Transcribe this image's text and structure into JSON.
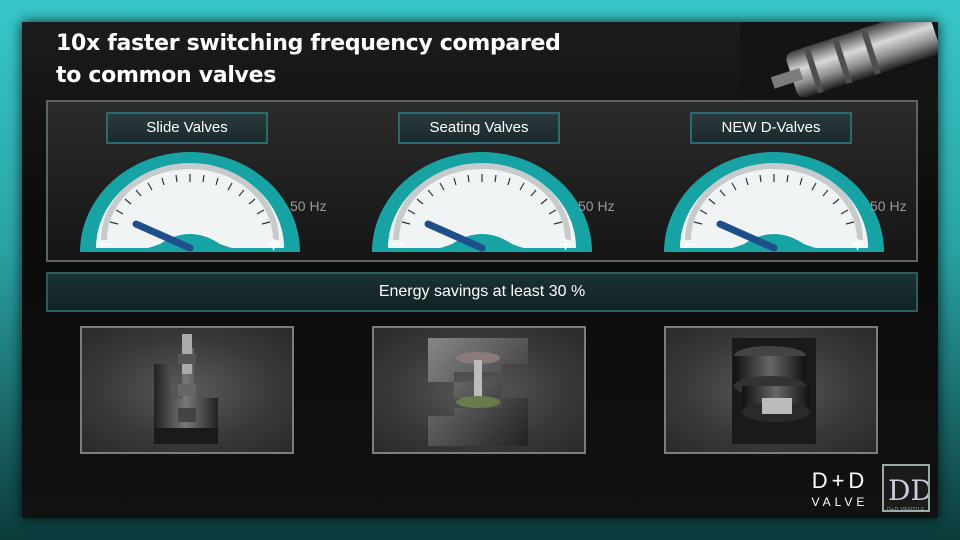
{
  "slide": {
    "title_line1": "10x faster switching frequency compared",
    "title_line2": "to common valves"
  },
  "gauges": [
    {
      "label": "Slide Valves",
      "unit_label": "50 Hz",
      "minus": "−",
      "plus": "+",
      "level": 0.12
    },
    {
      "label": "Seating Valves",
      "unit_label": "50 Hz",
      "minus": "−",
      "plus": "+",
      "level": 0.12
    },
    {
      "label": "NEW D-Valves",
      "unit_label": "50 Hz",
      "minus": "−",
      "plus": "+",
      "level": 0.12
    }
  ],
  "energy": {
    "text": "Energy savings at least 30 %"
  },
  "logo": {
    "brand": "D+D",
    "sub": "VALVE",
    "mark": "DD",
    "mark_sub": "D+D VENTILE"
  },
  "colors": {
    "accent": "#31b7b9",
    "gauge_teal": "#1aa5a6",
    "needle": "#1e4f8a"
  }
}
